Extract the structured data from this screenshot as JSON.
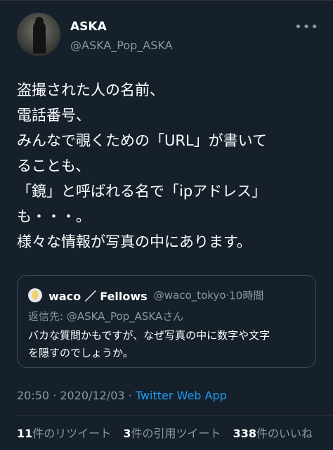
{
  "tweet": {
    "author_name": "ASKA",
    "author_handle": "@ASKA_Pop_ASKA",
    "more_icon": "more-dots-icon",
    "text": "盗撮された人の名前、\n電話番号、\nみんなで覗くための「URL」が書いて\nることも、\n「鏡」と呼ばれる名で「ipアドレス」\nも・・・。\n様々な情報が写真の中にあります。",
    "quoted": {
      "author_name": "waco ／ Fellows",
      "author_handle": "@waco_tokyo",
      "separator": "·",
      "time": "10時間",
      "reply_to": "返信先: @ASKA_Pop_ASKAさん",
      "text": "バカな質問かもですが、なぜ写真の中に数字や文字\nを隠すのでしょうか。"
    },
    "timestamp": "20:50 · 2020/12/03 · ",
    "source": "Twitter Web App",
    "stats": {
      "retweets_count": "11",
      "retweets_label": "件のリツイート",
      "quotes_count": "3",
      "quotes_label": "件の引用ツイート",
      "likes_count": "338",
      "likes_label": "件のいいね"
    }
  },
  "colors": {
    "background": "#15202b",
    "secondary_text": "#8b98a5",
    "link": "#1d9bf0",
    "border": "#3d4b59"
  }
}
